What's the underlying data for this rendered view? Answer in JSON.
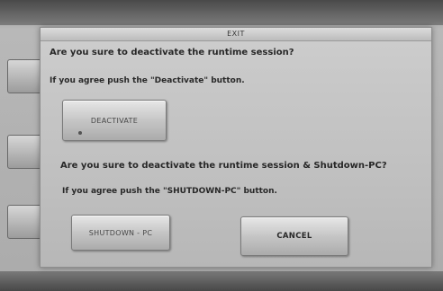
{
  "dialog": {
    "title": "EXIT",
    "question_deactivate": "Are you sure to deactivate the runtime session?",
    "instruction_deactivate": "If you agree push the \"Deactivate\" button.",
    "deactivate_label": "DEACTIVATE",
    "question_shutdown": "Are you sure to deactivate the runtime session & Shutdown-PC?",
    "instruction_shutdown": "If you agree push the \"SHUTDOWN-PC\" button.",
    "shutdown_label": "SHUTDOWN - PC",
    "cancel_label": "CANCEL"
  }
}
